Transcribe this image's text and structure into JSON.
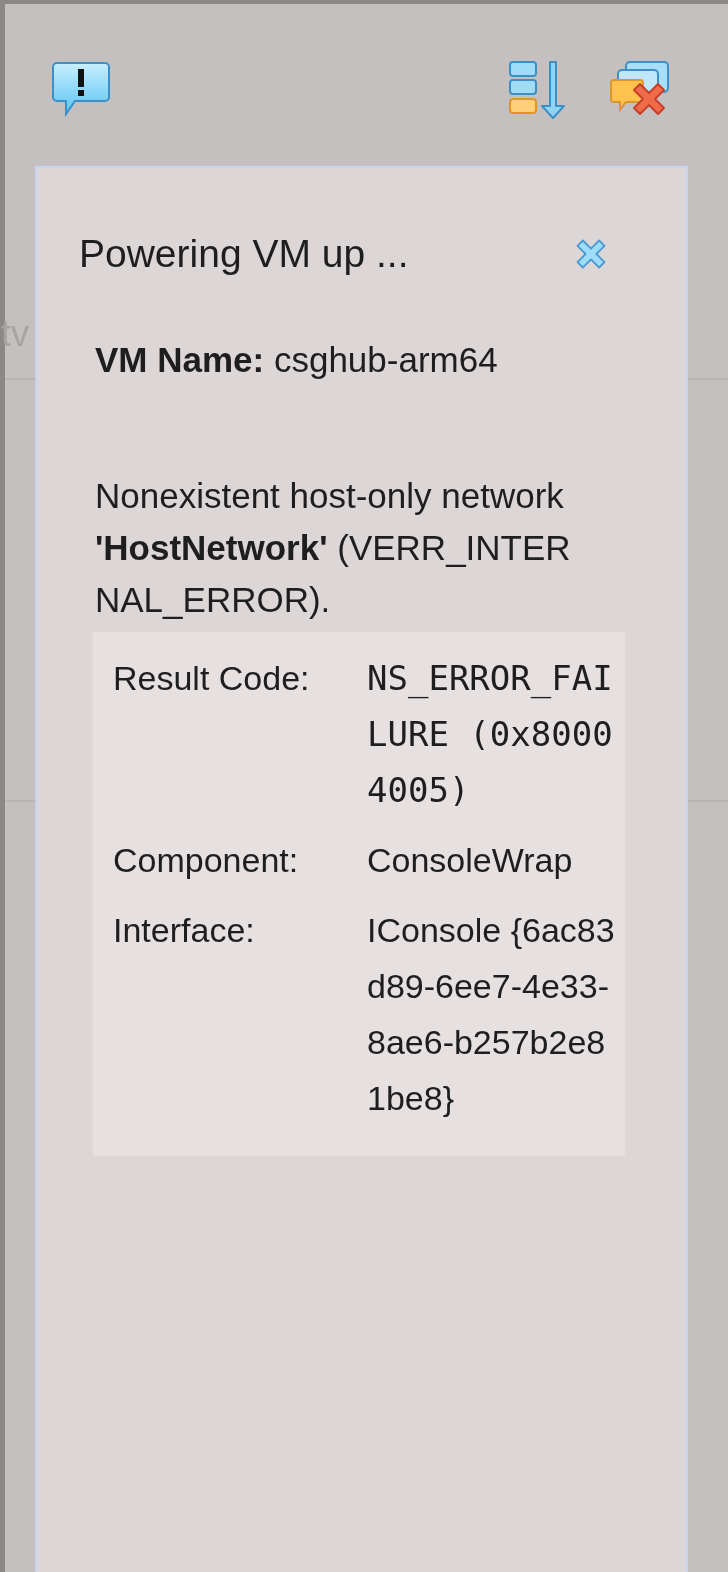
{
  "toolbar": {
    "buttons": [
      {
        "kind": "alert"
      },
      {
        "kind": "sort"
      },
      {
        "kind": "close-all"
      }
    ]
  },
  "background_text": "tv",
  "notification": {
    "title": "Powering VM up ...",
    "vm_name_label": "VM Name:",
    "vm_name": "csghub-arm64",
    "message": "Nonexistent host-only network **'HostNetwork'** (VERR_INTERNAL_ERROR).",
    "details": [
      {
        "label": "Result Code:",
        "value": "NS_ERROR_FAILURE (0x80004005)",
        "kind": "mono"
      },
      {
        "label": "Component:",
        "value": "ConsoleWrap",
        "kind": "text"
      },
      {
        "label": "Interface:",
        "value": "IConsole {6ac83d89-6ee7-4e33-8ae6-b257b2e81be8}",
        "kind": "text"
      }
    ]
  }
}
